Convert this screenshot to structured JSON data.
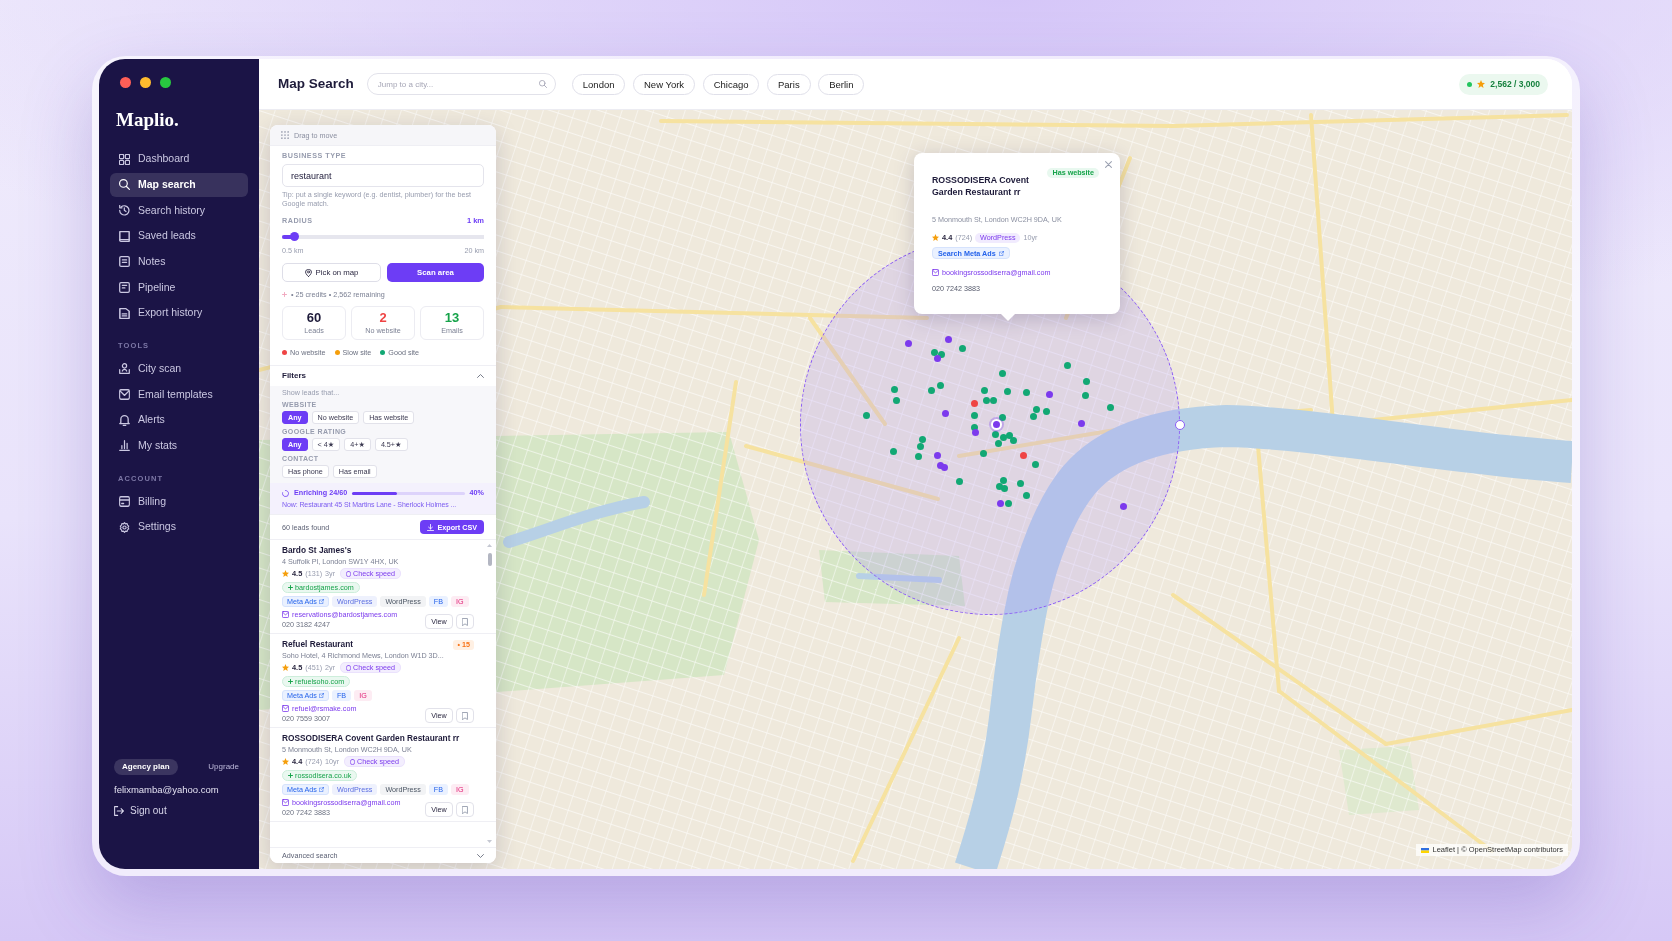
{
  "sidebar": {
    "logo": "Maplio.",
    "groups": [
      {
        "items": [
          {
            "label": "Dashboard",
            "selected": false
          },
          {
            "label": "Map search",
            "selected": true
          },
          {
            "label": "Search history",
            "selected": false
          },
          {
            "label": "Saved leads",
            "selected": false
          },
          {
            "label": "Notes",
            "selected": false
          },
          {
            "label": "Pipeline",
            "selected": false
          },
          {
            "label": "Export history",
            "selected": false
          }
        ]
      },
      {
        "heading": "TOOLS",
        "items": [
          {
            "label": "City scan",
            "selected": false
          },
          {
            "label": "Email templates",
            "selected": false
          },
          {
            "label": "Alerts",
            "selected": false
          },
          {
            "label": "My stats",
            "selected": false
          }
        ]
      },
      {
        "heading": "ACCOUNT",
        "items": [
          {
            "label": "Billing",
            "selected": false
          },
          {
            "label": "Settings",
            "selected": false
          }
        ]
      }
    ],
    "plan": "Agency plan",
    "upgrade": "Upgrade",
    "email": "felixmamba@yahoo.com",
    "sign_out": "Sign out"
  },
  "topbar": {
    "title": "Map Search",
    "search": {
      "placeholder": "Jump to a city..."
    },
    "cities": [
      "London",
      "New York",
      "Chicago",
      "Paris",
      "Berlin"
    ],
    "credits": "2,562 / 3,000"
  },
  "panel": {
    "handle": "Drag to move",
    "business_type": {
      "label": "BUSINESS TYPE",
      "value": "restaurant",
      "tip": "Tip: put a single keyword (e.g. dentist, plumber) for the best Google match."
    },
    "radius": {
      "label": "RADIUS",
      "reading": "1 km",
      "level": 0.06,
      "min": "0.5 km",
      "max": "20 km"
    },
    "buttons": [
      {
        "label": "Pick on map",
        "kind": "outline"
      },
      {
        "label": "Scan area",
        "kind": "primary"
      }
    ],
    "cost": "• 25 credits • 2,562 remaining",
    "stats": [
      {
        "value": "60",
        "label": "Leads",
        "color": "#1e1b3a"
      },
      {
        "value": "2",
        "label": "No website",
        "color": "#ef4444"
      },
      {
        "value": "13",
        "label": "Emails",
        "color": "#16a34a"
      }
    ],
    "legend": [
      {
        "label": "No website",
        "color": "#ef4444"
      },
      {
        "label": "Slow site",
        "color": "#f59e0b"
      },
      {
        "label": "Good site",
        "color": "#12a874"
      }
    ],
    "filters": {
      "title": "Filters",
      "expanded": true,
      "hint": "Show leads that...",
      "groups": [
        {
          "label": "WEBSITE",
          "options": [
            {
              "label": "Any",
              "selected": true
            },
            {
              "label": "No website",
              "selected": false
            },
            {
              "label": "Has website",
              "selected": false
            }
          ]
        },
        {
          "label": "GOOGLE RATING",
          "options": [
            {
              "label": "Any",
              "selected": true
            },
            {
              "label": "< 4★",
              "selected": false
            },
            {
              "label": "4+★",
              "selected": false
            },
            {
              "label": "4.5+★",
              "selected": false
            }
          ]
        },
        {
          "label": "CONTACT",
          "options": [
            {
              "label": "Has phone",
              "selected": false
            },
            {
              "label": "Has email",
              "selected": false
            }
          ]
        }
      ]
    },
    "enrichment": {
      "label": "Enriching 24/60",
      "level": 0.4,
      "reading": "40%",
      "now": "Now: Restaurant 45 St Martins Lane - Sherlock Holmes ..."
    },
    "results": {
      "count": "60 leads found",
      "export": "Export CSV"
    },
    "leads": [
      {
        "name": "Bardo St James's",
        "address": "4 Suffolk Pl, London SW1Y 4HX, UK",
        "rating": "4.5",
        "reviews": "(131)",
        "age": "3yr",
        "speed": "Check speed",
        "website": "bardostjames.com",
        "tags": [
          {
            "label": "Meta Ads",
            "kind": "meta"
          },
          {
            "label": "WordPress",
            "kind": "cms"
          },
          {
            "label": "WordPress",
            "kind": "plain"
          },
          {
            "label": "FB",
            "kind": "fb"
          },
          {
            "label": "IG",
            "kind": "ig"
          }
        ],
        "email": "reservations@bardostjames.com",
        "phone": "020 3182 4247",
        "action": "View"
      },
      {
        "name": "Refuel Restaurant",
        "badge": "• 15",
        "address": "Soho Hotel, 4 Richmond Mews, London W1D 3D...",
        "rating": "4.5",
        "reviews": "(451)",
        "age": "2yr",
        "speed": "Check speed",
        "website": "refuelsoho.com",
        "tags": [
          {
            "label": "Meta Ads",
            "kind": "meta"
          },
          {
            "label": "FB",
            "kind": "fb"
          },
          {
            "label": "IG",
            "kind": "ig"
          }
        ],
        "email": "refuel@rsmake.com",
        "phone": "020 7559 3007",
        "action": "View"
      },
      {
        "name": "ROSSODISERA Covent Garden Restaurant rr",
        "address": "5 Monmouth St, London WC2H 9DA, UK",
        "rating": "4.4",
        "reviews": "(724)",
        "age": "10yr",
        "speed": "Check speed",
        "website": "rossodisera.co.uk",
        "tags": [
          {
            "label": "Meta Ads",
            "kind": "meta"
          },
          {
            "label": "WordPress",
            "kind": "cms"
          },
          {
            "label": "WordPress",
            "kind": "plain"
          },
          {
            "label": "FB",
            "kind": "fb"
          },
          {
            "label": "IG",
            "kind": "ig"
          }
        ],
        "email": "bookingsrossodiserra@gmail.com",
        "phone": "020 7242 3883",
        "action": "View"
      }
    ],
    "advanced": "Advanced search"
  },
  "map": {
    "markers": [
      {
        "color": "#7c3aed",
        "selected": false
      },
      {
        "color": "#7c3aed",
        "selected": false
      },
      {
        "color": "#12a874",
        "selected": false
      },
      {
        "color": "#12a874",
        "selected": false
      },
      {
        "color": "#7c3aed",
        "selected": false
      },
      {
        "color": "#12a874",
        "selected": false
      },
      {
        "color": "#12a874",
        "selected": false
      },
      {
        "color": "#12a874",
        "selected": false
      },
      {
        "color": "#12a874",
        "selected": false
      },
      {
        "color": "#12a874",
        "selected": false
      },
      {
        "color": "#12a874",
        "selected": false
      },
      {
        "color": "#12a874",
        "selected": false
      },
      {
        "color": "#12a874",
        "selected": false
      },
      {
        "color": "#12a874",
        "selected": false
      },
      {
        "color": "#12a874",
        "selected": false
      },
      {
        "color": "#12a874",
        "selected": false
      },
      {
        "color": "#7c3aed",
        "selected": false
      },
      {
        "color": "#12a874",
        "selected": false
      },
      {
        "color": "#ef4444",
        "selected": false
      },
      {
        "color": "#12a874",
        "selected": false
      },
      {
        "color": "#12a874",
        "selected": false
      },
      {
        "color": "#12a874",
        "selected": false
      },
      {
        "color": "#12a874",
        "selected": false
      },
      {
        "color": "#12a874",
        "selected": false
      },
      {
        "color": "#12a874",
        "selected": false
      },
      {
        "color": "#12a874",
        "selected": false
      },
      {
        "color": "#7c3aed",
        "selected": false
      },
      {
        "color": "#12a874",
        "selected": false
      },
      {
        "color": "#7c3aed",
        "selected": true
      },
      {
        "color": "#12a874",
        "selected": false
      },
      {
        "color": "#12a874",
        "selected": false
      },
      {
        "color": "#7c3aed",
        "selected": false
      },
      {
        "color": "#12a874",
        "selected": false
      },
      {
        "color": "#12a874",
        "selected": false
      },
      {
        "color": "#12a874",
        "selected": false
      },
      {
        "color": "#12a874",
        "selected": false
      },
      {
        "color": "#12a874",
        "selected": false
      },
      {
        "color": "#7c3aed",
        "selected": false
      },
      {
        "color": "#12a874",
        "selected": false
      },
      {
        "color": "#12a874",
        "selected": false
      },
      {
        "color": "#12a874",
        "selected": false
      },
      {
        "color": "#12a874",
        "selected": false
      },
      {
        "color": "#7c3aed",
        "selected": false
      },
      {
        "color": "#12a874",
        "selected": false
      },
      {
        "color": "#ef4444",
        "selected": false
      },
      {
        "color": "#12a874",
        "selected": false
      },
      {
        "color": "#7c3aed",
        "selected": false
      },
      {
        "color": "#7c3aed",
        "selected": false
      },
      {
        "color": "#12a874",
        "selected": false
      },
      {
        "color": "#12a874",
        "selected": false
      },
      {
        "color": "#12a874",
        "selected": false
      },
      {
        "color": "#12a874",
        "selected": false
      },
      {
        "color": "#12a874",
        "selected": false
      },
      {
        "color": "#12a874",
        "selected": false
      },
      {
        "color": "#7c3aed",
        "selected": false
      },
      {
        "color": "#12a874",
        "selected": false
      },
      {
        "color": "#7c3aed",
        "selected": false
      }
    ],
    "popup": {
      "title": "ROSSODISERA Covent Garden Restaurant rr",
      "badge": "Has website",
      "address": "5 Monmouth St, London WC2H 9DA, UK",
      "rating": "4.4",
      "reviews": "(724)",
      "cms": "WordPress",
      "age": "10yr",
      "meta_link": "Search Meta Ads",
      "email": "bookingsrossodiserra@gmail.com",
      "phone": "020 7242 3883"
    },
    "attribution": {
      "leaflet": "Leaflet",
      "separator": "| ©",
      "osm": "OpenStreetMap",
      "suffix": "contributors"
    }
  }
}
